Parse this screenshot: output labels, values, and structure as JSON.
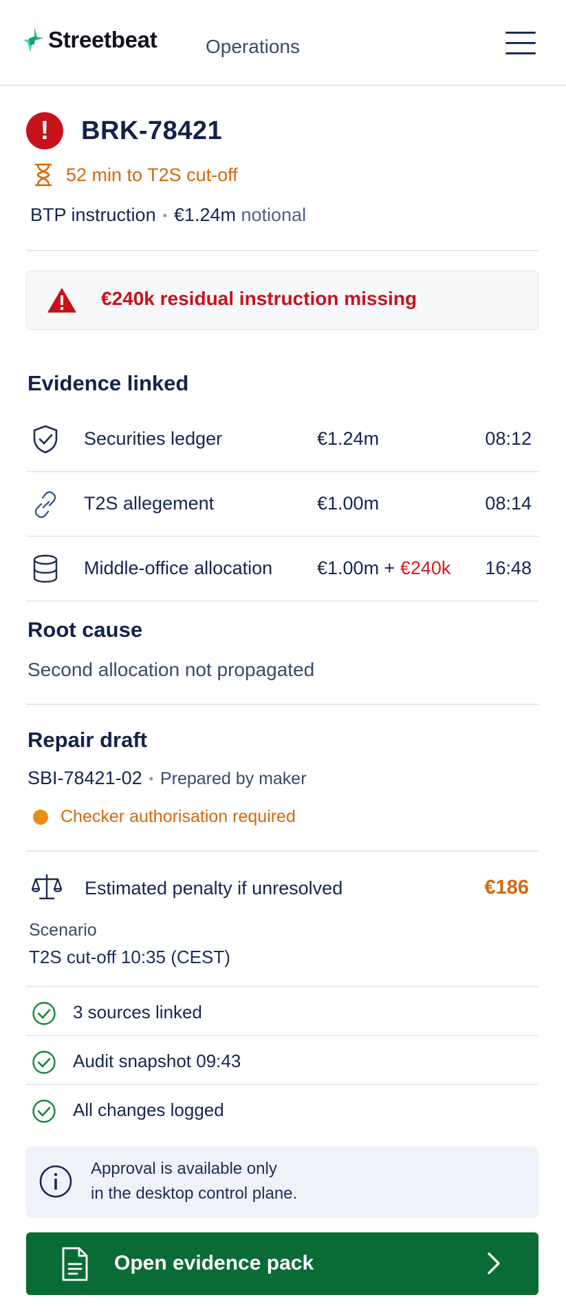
{
  "app": {
    "brand": "Streetbeat",
    "nav_label": "Operations"
  },
  "case": {
    "id": "BRK-78421",
    "timer": "52 min to T2S cut-off",
    "instruction": "BTP instruction",
    "notional_amount": "€1.24m",
    "notional_label": "notional"
  },
  "alert": {
    "text": "€240k residual instruction missing"
  },
  "evidence": {
    "title": "Evidence linked",
    "rows": [
      {
        "icon": "shield-check-icon",
        "name": "Securities ledger",
        "amount": "€1.24m",
        "amount_extra": "",
        "time": "08:12"
      },
      {
        "icon": "link-icon",
        "name": "T2S allegement",
        "amount": "€1.00m",
        "amount_extra": "",
        "time": "08:14"
      },
      {
        "icon": "database-icon",
        "name": "Middle-office allocation",
        "amount": "€1.00m + ",
        "amount_extra": "€240k",
        "time": "16:48"
      }
    ]
  },
  "root_cause": {
    "title": "Root cause",
    "text": "Second allocation not propagated"
  },
  "repair": {
    "title": "Repair draft",
    "id": "SBI-78421-02",
    "prepared": "Prepared by maker",
    "status": "Checker authorisation required"
  },
  "penalty": {
    "label": "Estimated penalty if unresolved",
    "value": "€186",
    "scenario_label": "Scenario",
    "scenario_value": "T2S cut-off 10:35 (CEST)"
  },
  "checks": [
    "3 sources linked",
    "Audit snapshot 09:43",
    "All changes logged"
  ],
  "info": {
    "line1": "Approval is available only",
    "line2": "in the desktop control plane."
  },
  "cta": {
    "label": "Open evidence pack"
  },
  "colors": {
    "accent_red": "#c8121b",
    "accent_orange": "#d3690d",
    "primary_green": "#0b6b35",
    "navy": "#17264f",
    "check_green": "#14853d"
  }
}
